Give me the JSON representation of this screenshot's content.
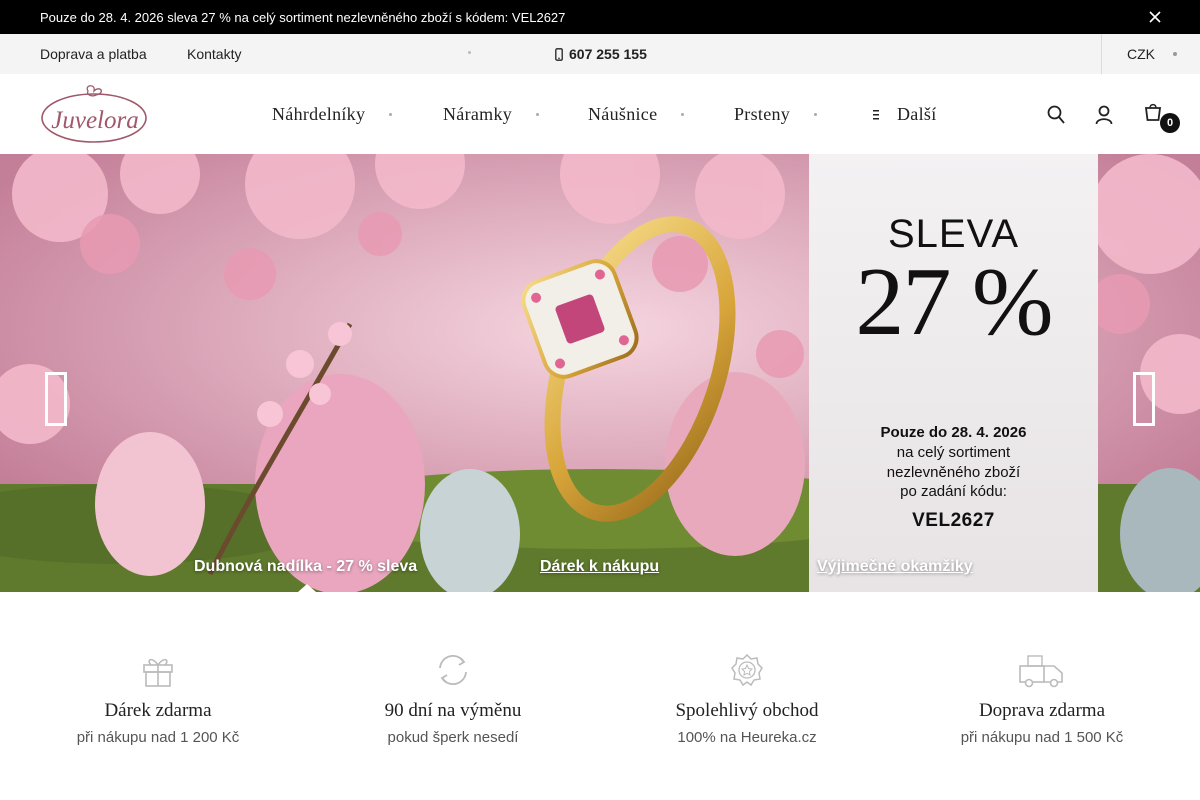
{
  "announcement": {
    "text": "Pouze do 28. 4. 2026 sleva 27 % na celý sortiment nezlevněného zboží s kódem: VEL2627"
  },
  "utility": {
    "shipping_link": "Doprava a platba",
    "contacts_link": "Kontakty",
    "phone": "607 255 155",
    "currency": "CZK"
  },
  "header": {
    "logo_text": "Juvelora",
    "nav": [
      {
        "label": "Náhrdelníky"
      },
      {
        "label": "Náramky"
      },
      {
        "label": "Náušnice"
      },
      {
        "label": "Prsteny"
      },
      {
        "label": "Další"
      }
    ],
    "cart_count": "0",
    "icons": [
      "search-icon",
      "user-icon",
      "cart-icon"
    ]
  },
  "hero": {
    "promo": {
      "heading": "SLEVA",
      "percent": "27 %",
      "line1": "Pouze do 28. 4. 2026",
      "line2": "na celý sortiment",
      "line3": "nezlevněného zboží",
      "line4": "po zadání kódu:",
      "code": "VEL2627"
    },
    "tabs": [
      {
        "label": "Dubnová nadílka - 27 % sleva"
      },
      {
        "label": "Dárek k nákupu"
      },
      {
        "label": "Výjimečné okamžiky"
      }
    ]
  },
  "features": [
    {
      "title": "Dárek zdarma",
      "subtitle": "při nákupu nad 1 200 Kč",
      "icon": "gift-icon"
    },
    {
      "title": "90 dní na výměnu",
      "subtitle": "pokud šperk nesedí",
      "icon": "exchange-icon"
    },
    {
      "title": "Spolehlivý obchod",
      "subtitle": "100% na Heureka.cz",
      "icon": "trust-badge-icon"
    },
    {
      "title": "Doprava zdarma",
      "subtitle": "při nákupu nad 1 500 Kč",
      "icon": "truck-icon"
    }
  ],
  "colors": {
    "accent": "#a0586b",
    "announce_bg": "#000000",
    "utility_bg": "#f4f4f4"
  }
}
